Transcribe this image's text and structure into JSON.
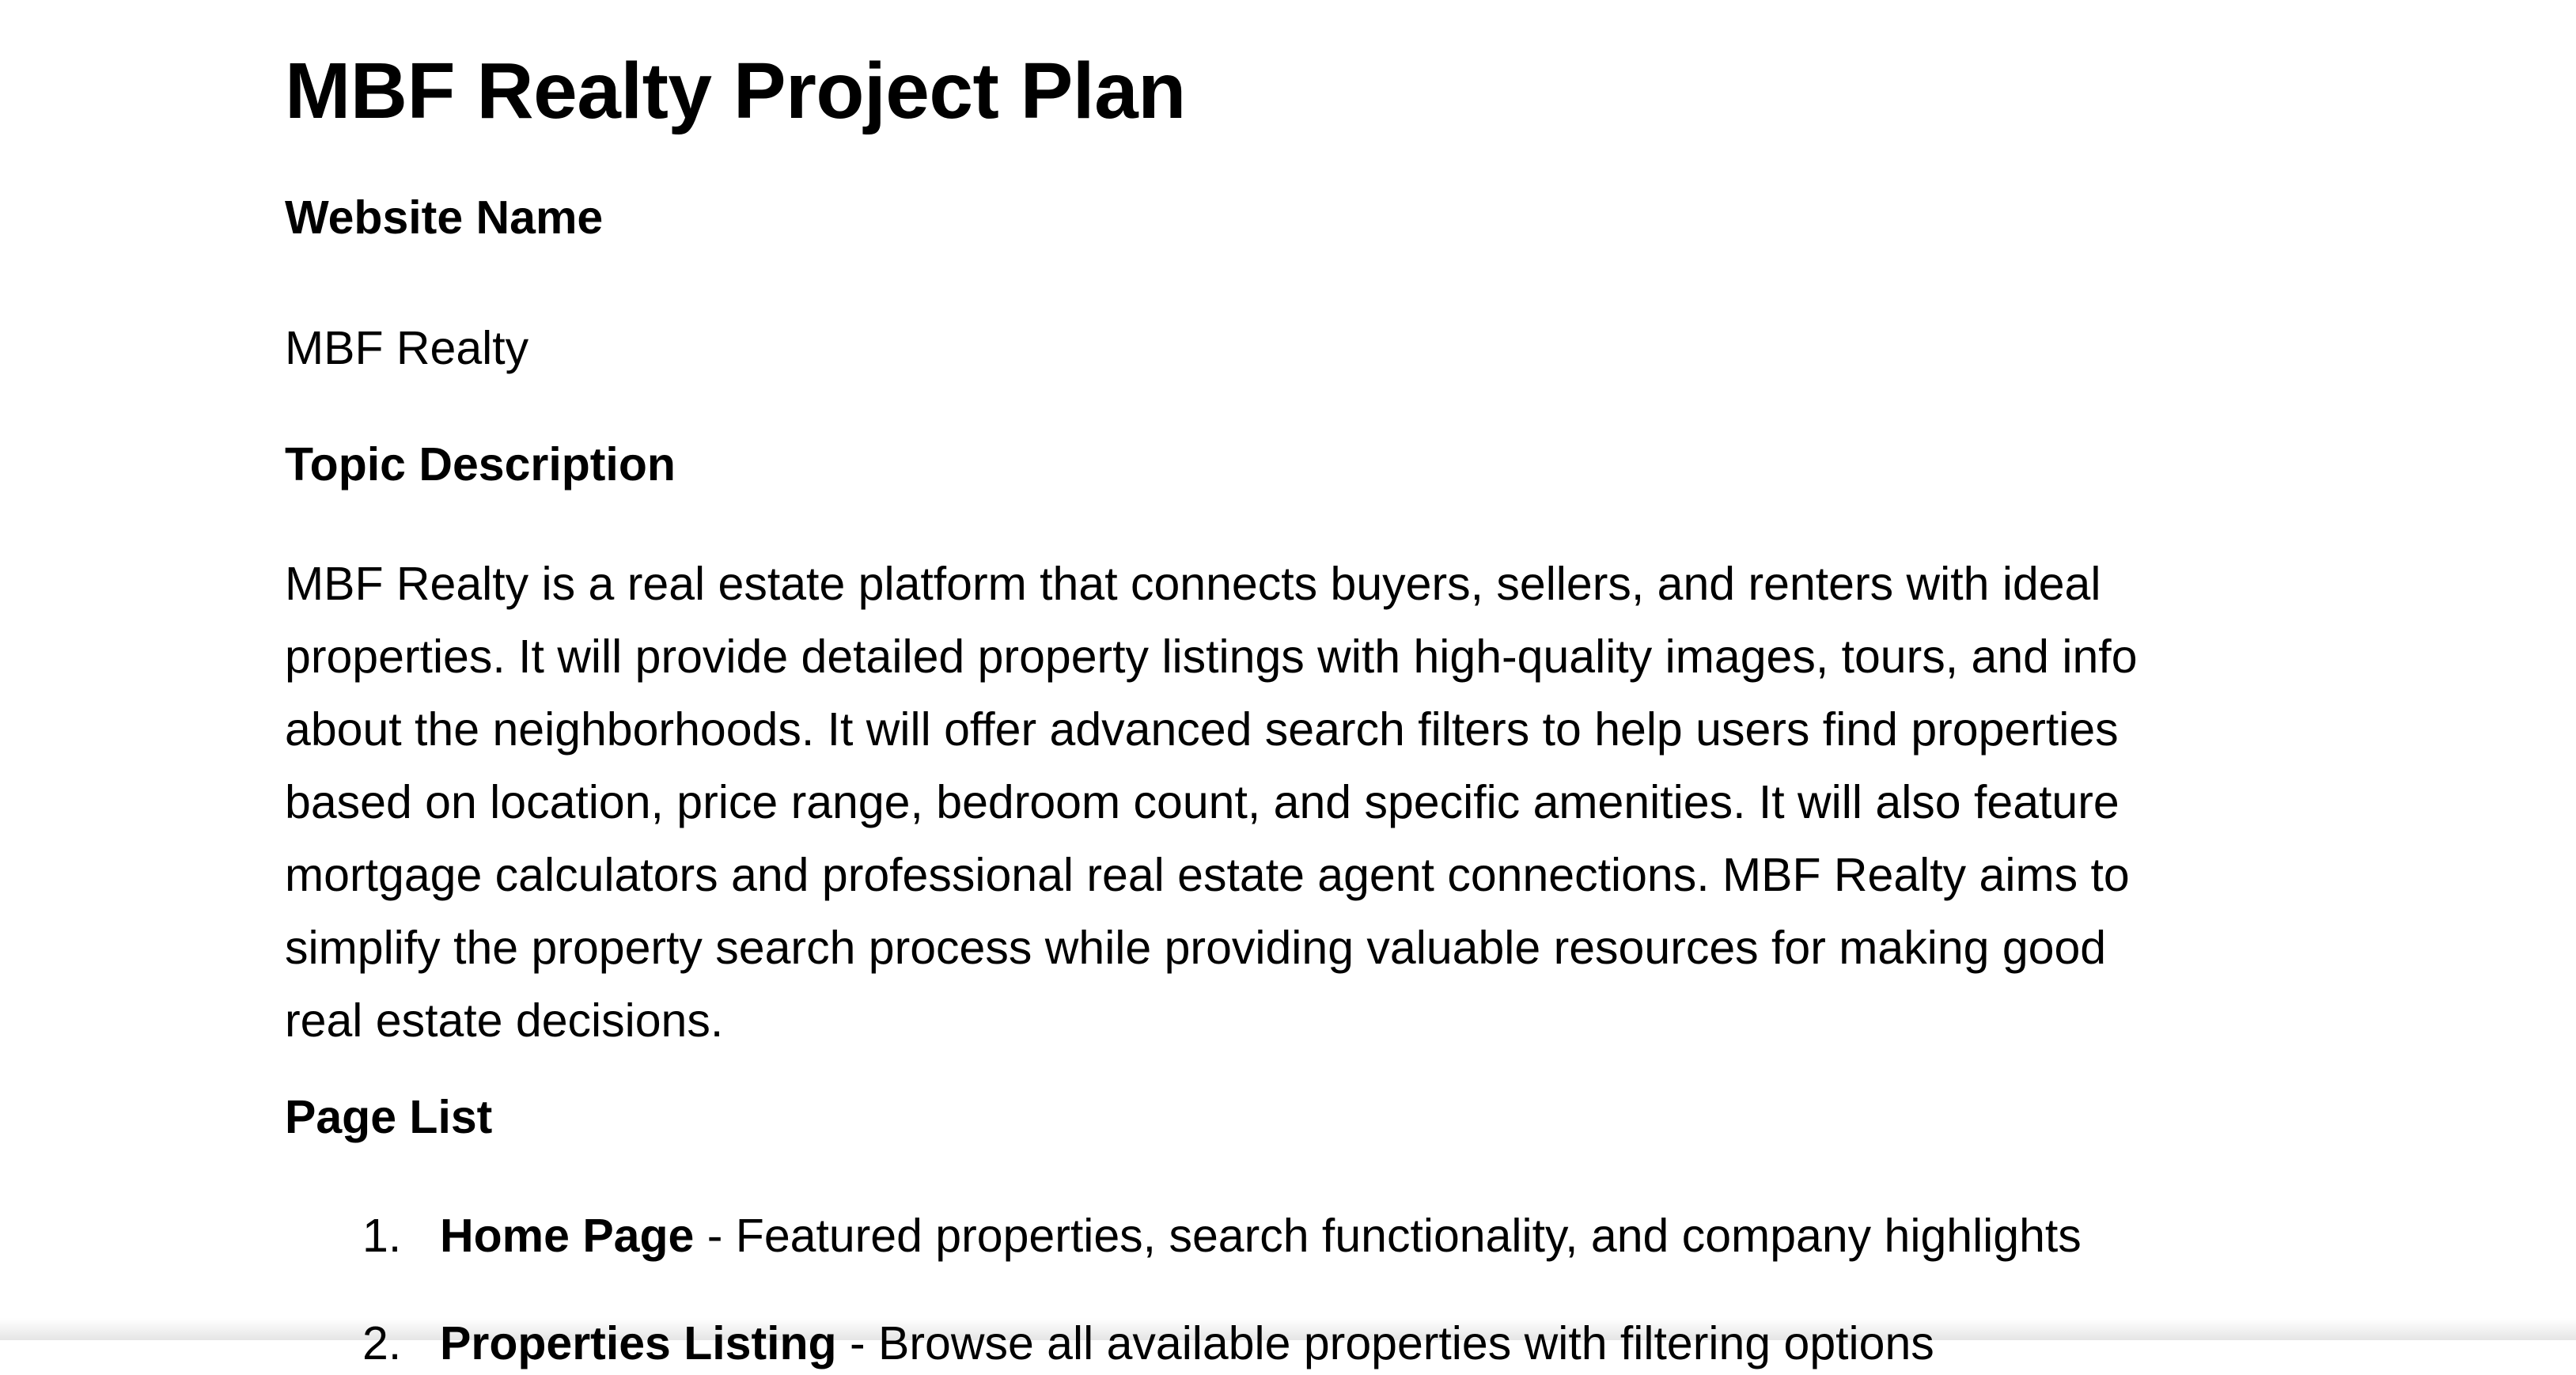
{
  "document": {
    "title": "MBF Realty Project Plan",
    "sections": {
      "website_name": {
        "heading": "Website Name",
        "body": "MBF Realty"
      },
      "topic_description": {
        "heading": "Topic Description",
        "lines": [
          "MBF Realty is a real estate platform that connects buyers, sellers, and renters with ideal",
          "properties. It will provide detailed property listings with high-quality images, tours, and info",
          "about the neighborhoods. It will offer advanced search filters to help users find properties",
          "based on location, price range, bedroom count, and specific amenities. It will also feature",
          "mortgage calculators and professional real estate agent connections. MBF Realty aims to",
          "simplify the property search process while providing valuable resources for making good",
          "real estate decisions."
        ]
      },
      "page_list": {
        "heading": "Page List",
        "items": [
          {
            "number": "1.",
            "name": "Home Page",
            "description": " - Featured properties, search functionality, and company highlights"
          },
          {
            "number": "2.",
            "name": "Properties Listing",
            "description": " - Browse all available properties with filtering options"
          }
        ]
      }
    }
  }
}
